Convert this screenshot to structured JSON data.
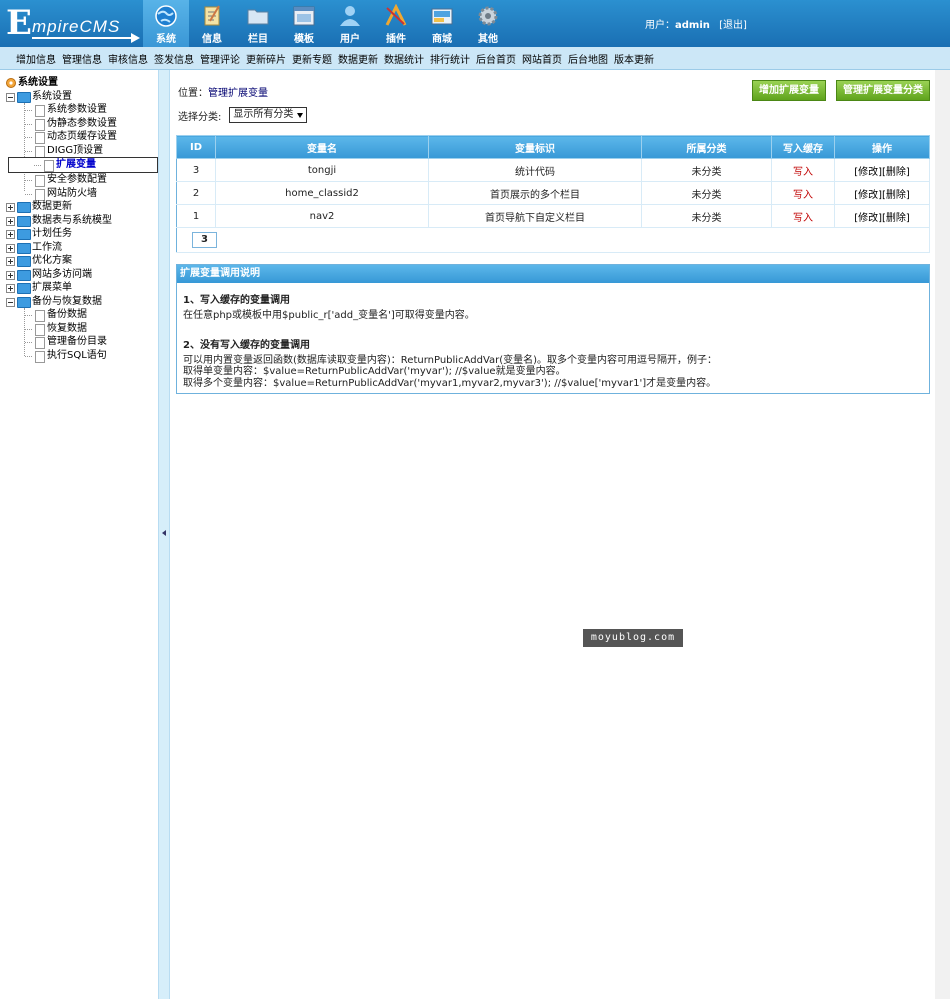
{
  "logo": {
    "e": "E",
    "text": "mpireCMS"
  },
  "nav": [
    {
      "label": "系统",
      "icon": "globe-icon",
      "active": true
    },
    {
      "label": "信息",
      "icon": "notepad-icon"
    },
    {
      "label": "栏目",
      "icon": "folder-icon"
    },
    {
      "label": "模板",
      "icon": "template-icon"
    },
    {
      "label": "用户",
      "icon": "user-icon"
    },
    {
      "label": "插件",
      "icon": "tools-icon"
    },
    {
      "label": "商城",
      "icon": "shop-icon"
    },
    {
      "label": "其他",
      "icon": "gear-icon"
    }
  ],
  "user": {
    "prefix": "用户：",
    "name": "admin",
    "logout": "[退出]"
  },
  "submenu": [
    "增加信息",
    "管理信息",
    "审核信息",
    "签发信息",
    "管理评论",
    "更新碎片",
    "更新专题",
    "数据更新",
    "数据统计",
    "排行统计",
    "后台首页",
    "网站首页",
    "后台地图",
    "版本更新"
  ],
  "tree": {
    "root": "系统设置",
    "sys": "系统设置",
    "sys_children": [
      "系统参数设置",
      "伪静态参数设置",
      "动态页缓存设置",
      "DIGG顶设置",
      "扩展变量",
      "安全参数配置",
      "网站防火墙"
    ],
    "groups": [
      "数据更新",
      "数据表与系统模型",
      "计划任务",
      "工作流",
      "优化方案",
      "网站多访问端",
      "扩展菜单"
    ],
    "backup": "备份与恢复数据",
    "backup_children": [
      "备份数据",
      "恢复数据",
      "管理备份目录",
      "执行SQL语句"
    ]
  },
  "position": {
    "label": "位置：",
    "link": "管理扩展变量"
  },
  "buttons": {
    "add": "增加扩展变量",
    "manage": "管理扩展变量分类"
  },
  "category": {
    "label": "选择分类:",
    "value": "显示所有分类"
  },
  "table": {
    "headers": [
      "ID",
      "变量名",
      "变量标识",
      "所属分类",
      "写入缓存",
      "操作"
    ],
    "rows": [
      {
        "id": "3",
        "name": "tongji",
        "mark": "统计代码",
        "cat": "未分类",
        "cache": "写入",
        "edit": "[修改]",
        "del": "[删除]"
      },
      {
        "id": "2",
        "name": "home_classid2",
        "mark": "首页展示的多个栏目",
        "cat": "未分类",
        "cache": "写入",
        "edit": "[修改]",
        "del": "[删除]"
      },
      {
        "id": "1",
        "name": "nav2",
        "mark": "首页导航下自定义栏目",
        "cat": "未分类",
        "cache": "写入",
        "edit": "[修改]",
        "del": "[删除]"
      }
    ],
    "page": "3"
  },
  "help": {
    "title": "扩展变量调用说明",
    "s1_title": "1、写入缓存的变量调用",
    "s1_text": "在任意php或模板中用$public_r['add_变量名']可取得变量内容。",
    "s2_title": "2、没有写入缓存的变量调用",
    "s2_l1": "可以用内置变量返回函数(数据库读取变量内容)：ReturnPublicAddVar(变量名)。取多个变量内容可用逗号隔开，例子：",
    "s2_l2": "取得单变量内容：$value=ReturnPublicAddVar('myvar'); //$value就是变量内容。",
    "s2_l3": "取得多个变量内容：$value=ReturnPublicAddVar('myvar1,myvar2,myvar3'); //$value['myvar1']才是变量内容。"
  },
  "watermark": "moyublog.com"
}
